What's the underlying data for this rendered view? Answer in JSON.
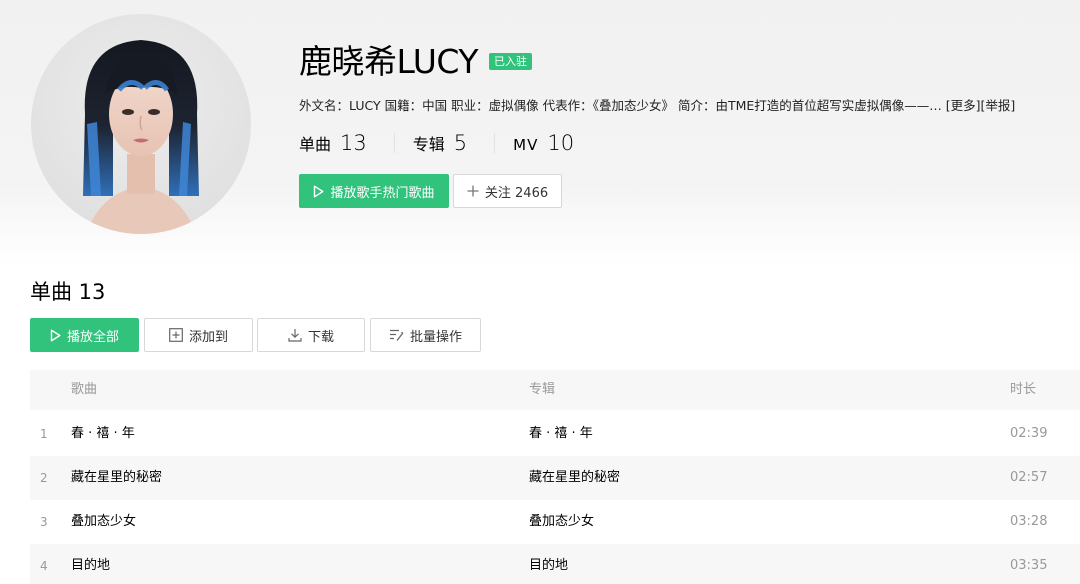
{
  "artist": {
    "name": "鹿晓希LUCY",
    "badge": "已入驻",
    "info": {
      "foreign_name_label": "外文名：",
      "foreign_name": "LUCY",
      "nationality_label": "国籍：",
      "nationality": "中国",
      "occupation_label": "职业：",
      "occupation": "虚拟偶像",
      "works_label": "代表作：",
      "works": "《叠加态少女》",
      "intro_label": "简介：",
      "intro": "由TME打造的首位超写实虚拟偶像——…",
      "more_link": "[更多]",
      "report_link": "[举报]"
    },
    "stats": {
      "singles_label": "单曲",
      "singles": "13",
      "albums_label": "专辑",
      "albums": "5",
      "mv_label": "MV",
      "mv": "10"
    },
    "play_hot_button": "播放歌手热门歌曲",
    "follow_button": "关注 2466"
  },
  "songs_section": {
    "title": "单曲 13",
    "toolbar": {
      "play_all": "播放全部",
      "add_to": "添加到",
      "download": "下载",
      "batch": "批量操作"
    },
    "columns": {
      "song": "歌曲",
      "album": "专辑",
      "duration": "时长"
    },
    "rows": [
      {
        "index": "1",
        "song": "春 · 禧 · 年",
        "album": "春 · 禧 · 年",
        "duration": "02:39"
      },
      {
        "index": "2",
        "song": "藏在星里的秘密",
        "album": "藏在星里的秘密",
        "duration": "02:57"
      },
      {
        "index": "3",
        "song": "叠加态少女",
        "album": "叠加态少女",
        "duration": "03:28"
      },
      {
        "index": "4",
        "song": "目的地",
        "album": "目的地",
        "duration": "03:35"
      }
    ]
  },
  "colors": {
    "accent": "#31c27c",
    "muted_text": "#999999",
    "stripe": "#f7f7f7"
  },
  "icons": {
    "play": "play-icon",
    "plus": "plus-icon",
    "add_box": "add-box-icon",
    "download": "download-icon",
    "batch": "batch-edit-icon"
  }
}
